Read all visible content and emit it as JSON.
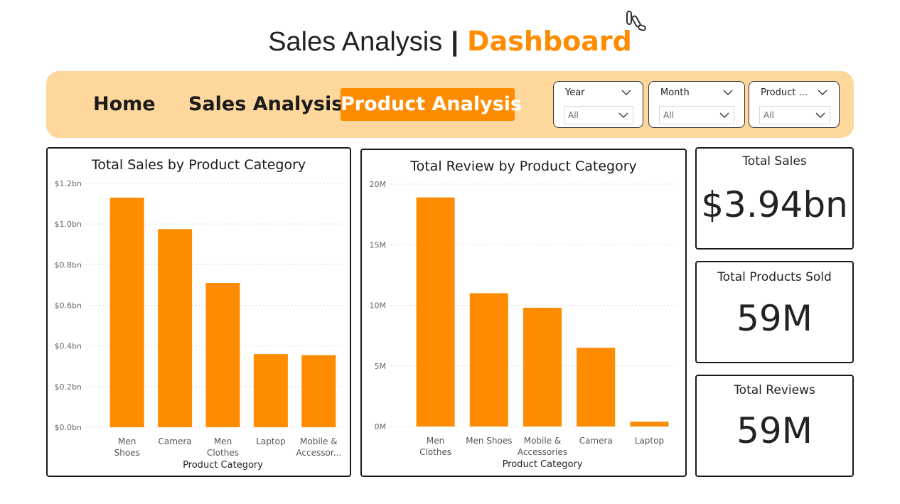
{
  "header": {
    "title_main": "Sales Analysis",
    "title_sep": "|",
    "title_accent": "Dashboard"
  },
  "colors": {
    "accent": "#ff8c00",
    "nav_bg": "#fdd79b",
    "bar": "#ff8c00"
  },
  "nav": {
    "home": "Home",
    "sales_analysis": "Sales Analysis",
    "product_analysis": "Product Analysis",
    "active": "Product Analysis"
  },
  "slicers": [
    {
      "label": "Year",
      "value": "All"
    },
    {
      "label": "Month",
      "value": "All"
    },
    {
      "label": "Product ...",
      "value": "All"
    }
  ],
  "kpis": {
    "total_sales": {
      "label": "Total Sales",
      "value": "$3.94bn"
    },
    "total_products_sold": {
      "label": "Total Products Sold",
      "value": "59M"
    },
    "total_reviews": {
      "label": "Total Reviews",
      "value": "59M"
    }
  },
  "chart_data": [
    {
      "type": "bar",
      "title": "Total Sales by Product Category",
      "xlabel": "Product Category",
      "ylabel": "",
      "categories": [
        [
          "Men",
          "Shoes"
        ],
        [
          "Camera"
        ],
        [
          "Men",
          "Clothes"
        ],
        [
          "Laptop"
        ],
        [
          "Mobile &",
          "Accessor..."
        ]
      ],
      "values": [
        1.13,
        0.975,
        0.71,
        0.36,
        0.355
      ],
      "unit": "bn",
      "ylim": [
        0,
        1.2
      ],
      "ticks": [
        "$0.0bn",
        "$0.2bn",
        "$0.4bn",
        "$0.6bn",
        "$0.8bn",
        "$1.0bn",
        "$1.2bn"
      ],
      "grid": true
    },
    {
      "type": "bar",
      "title": "Total Review by Product Category",
      "xlabel": "Product Category",
      "ylabel": "",
      "categories": [
        [
          "Men",
          "Clothes"
        ],
        [
          "Men Shoes"
        ],
        [
          "Mobile &",
          "Accessories"
        ],
        [
          "Camera"
        ],
        [
          "Laptop"
        ]
      ],
      "values": [
        18.9,
        11.0,
        9.8,
        6.5,
        0.4
      ],
      "unit": "M",
      "ylim": [
        0,
        20
      ],
      "ticks": [
        "0M",
        "5M",
        "10M",
        "15M",
        "20M"
      ],
      "grid": true
    }
  ]
}
